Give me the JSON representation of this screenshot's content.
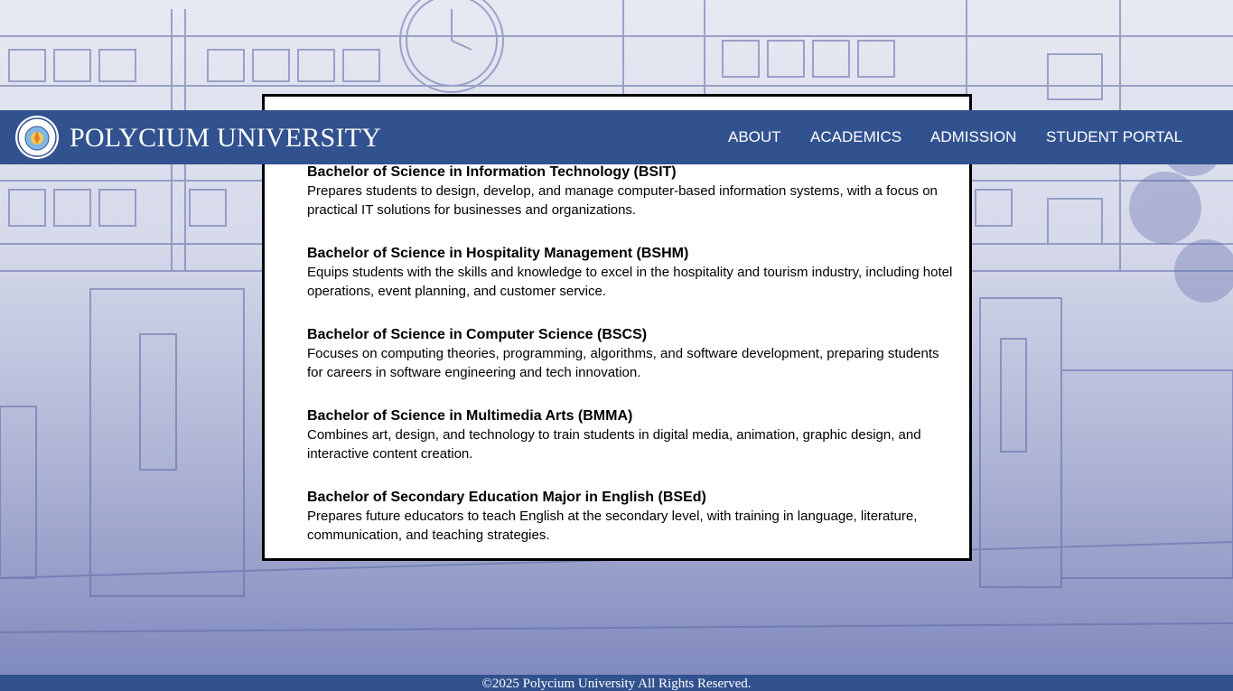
{
  "header": {
    "brand": "POLYCIUM UNIVERSITY",
    "nav": [
      {
        "label": "ABOUT"
      },
      {
        "label": "ACADEMICS"
      },
      {
        "label": "ADMISSION"
      },
      {
        "label": "STUDENT PORTAL"
      }
    ]
  },
  "programs": [
    {
      "title": "Bachelor of Science in Information Technology (BSIT)",
      "description": "Prepares students to design, develop, and manage computer-based information systems, with a focus on practical IT solutions for businesses and organizations."
    },
    {
      "title": "Bachelor of Science in Hospitality Management (BSHM)",
      "description": "Equips students with the skills and knowledge to excel in the hospitality and tourism industry, including hotel operations, event planning, and customer service."
    },
    {
      "title": "Bachelor of Science in Computer Science (BSCS)",
      "description": "Focuses on computing theories, programming, algorithms, and software development, preparing students for careers in software engineering and tech innovation."
    },
    {
      "title": "Bachelor of Science in Multimedia Arts (BMMA)",
      "description": "Combines art, design, and technology to train students in digital media, animation, graphic design, and interactive content creation."
    },
    {
      "title": "Bachelor of Secondary Education Major in English (BSEd)",
      "description": "Prepares future educators to teach English at the secondary level, with training in language, literature, communication, and teaching strategies."
    }
  ],
  "footer": {
    "copyright": "©2025 Polycium University All Rights Reserved."
  },
  "colors": {
    "header_bg": "#31528f",
    "panel_bg": "#ffffff",
    "sketch_line": "#5d6aa8"
  },
  "icons": {
    "logo": "university-seal-icon",
    "clock": "clock-icon"
  }
}
